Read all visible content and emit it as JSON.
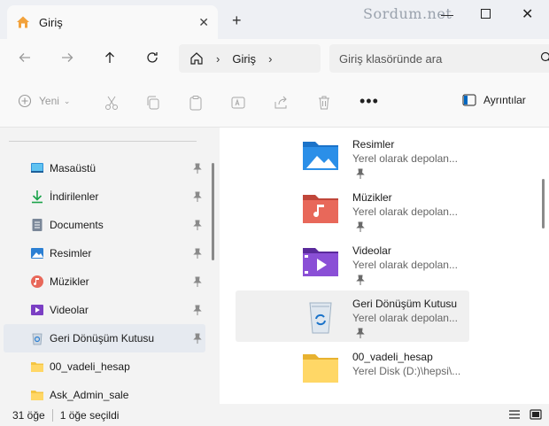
{
  "window": {
    "tab_title": "Giriş",
    "brand": "Sordum.net",
    "accent": "#0067c0"
  },
  "nav": {
    "breadcrumb": "Giriş",
    "search_placeholder": "Giriş klasöründe ara"
  },
  "toolbar": {
    "new_label": "Yeni",
    "more_label": "•••",
    "details_label": "Ayrıntılar"
  },
  "sidebar": {
    "items": [
      {
        "label": "Masaüstü",
        "icon": "desktop-icon",
        "pinned": true
      },
      {
        "label": "İndirilenler",
        "icon": "download-icon",
        "pinned": true
      },
      {
        "label": "Documents",
        "icon": "document-icon",
        "pinned": true
      },
      {
        "label": "Resimler",
        "icon": "pictures-icon",
        "pinned": true
      },
      {
        "label": "Müzikler",
        "icon": "music-icon",
        "pinned": true
      },
      {
        "label": "Videolar",
        "icon": "video-icon",
        "pinned": true
      },
      {
        "label": "Geri Dönüşüm Kutusu",
        "icon": "recycle-bin-icon",
        "pinned": true,
        "selected": true
      },
      {
        "label": "00_vadeli_hesap",
        "icon": "folder-icon",
        "pinned": false
      },
      {
        "label": "Ask_Admin_sale",
        "icon": "folder-icon",
        "pinned": false
      }
    ]
  },
  "content": {
    "items": [
      {
        "name": "Resimler",
        "sub": "Yerel olarak depolan...",
        "icon": "pictures-folder-icon",
        "pinned": true
      },
      {
        "name": "Müzikler",
        "sub": "Yerel olarak depolan...",
        "icon": "music-folder-icon",
        "pinned": true
      },
      {
        "name": "Videolar",
        "sub": "Yerel olarak depolan...",
        "icon": "video-folder-icon",
        "pinned": true
      },
      {
        "name": "Geri Dönüşüm Kutusu",
        "sub": "Yerel olarak depolan...",
        "icon": "recycle-bin-icon",
        "pinned": true,
        "highlighted": true
      },
      {
        "name": "00_vadeli_hesap",
        "sub": "Yerel Disk (D:)\\hepsi\\...",
        "icon": "folder-icon",
        "pinned": false
      }
    ]
  },
  "status": {
    "count": "31 öğe",
    "selected": "1 öğe seçildi"
  }
}
